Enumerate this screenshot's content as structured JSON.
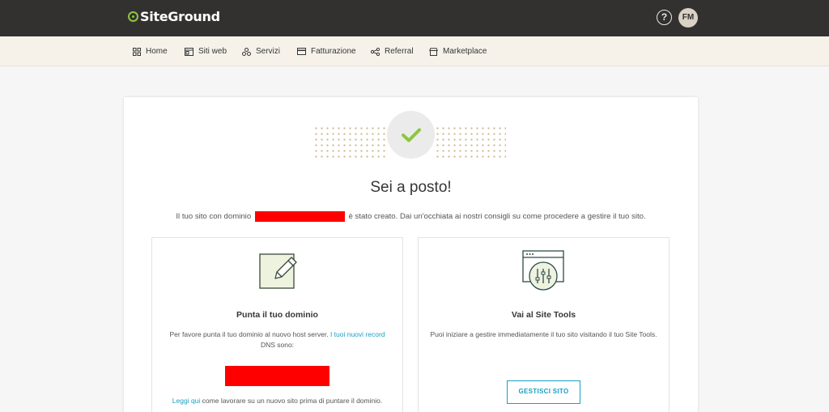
{
  "header": {
    "logo_text": "SiteGround",
    "help_label": "?",
    "avatar_initials": "FM"
  },
  "nav": {
    "items": [
      {
        "label": "Home",
        "icon": "grid-icon"
      },
      {
        "label": "Siti web",
        "icon": "website-icon"
      },
      {
        "label": "Servizi",
        "icon": "services-icon"
      },
      {
        "label": "Fatturazione",
        "icon": "billing-icon"
      },
      {
        "label": "Referral",
        "icon": "share-icon"
      },
      {
        "label": "Marketplace",
        "icon": "store-icon"
      }
    ]
  },
  "main": {
    "title": "Sei a posto!",
    "subtitle_before": "Il tuo sito con dominio",
    "subtitle_after": "è stato creato. Dai un'occhiata ai nostri consigli su come procedere a gestire il tuo sito."
  },
  "panels": {
    "domain": {
      "title": "Punta il tuo dominio",
      "text_before": "Per favore punta il tuo dominio al nuovo host server.",
      "text_highlight": "I tuoi nuovi record",
      "text_after": "DNS sono:",
      "link_label": "Leggi qui",
      "foot_text": "come lavorare su un nuovo sito prima di puntare il dominio."
    },
    "tools": {
      "title": "Vai al Site Tools",
      "text": "Puoi iniziare a gestire immediatamente il tuo sito visitando il tuo Site Tools.",
      "button_label": "GESTISCI SITO"
    }
  },
  "colors": {
    "topbar": "#333130",
    "brand_green": "#8dc63f",
    "accent_teal": "#1aa0c2",
    "redaction": "#ff0000"
  }
}
